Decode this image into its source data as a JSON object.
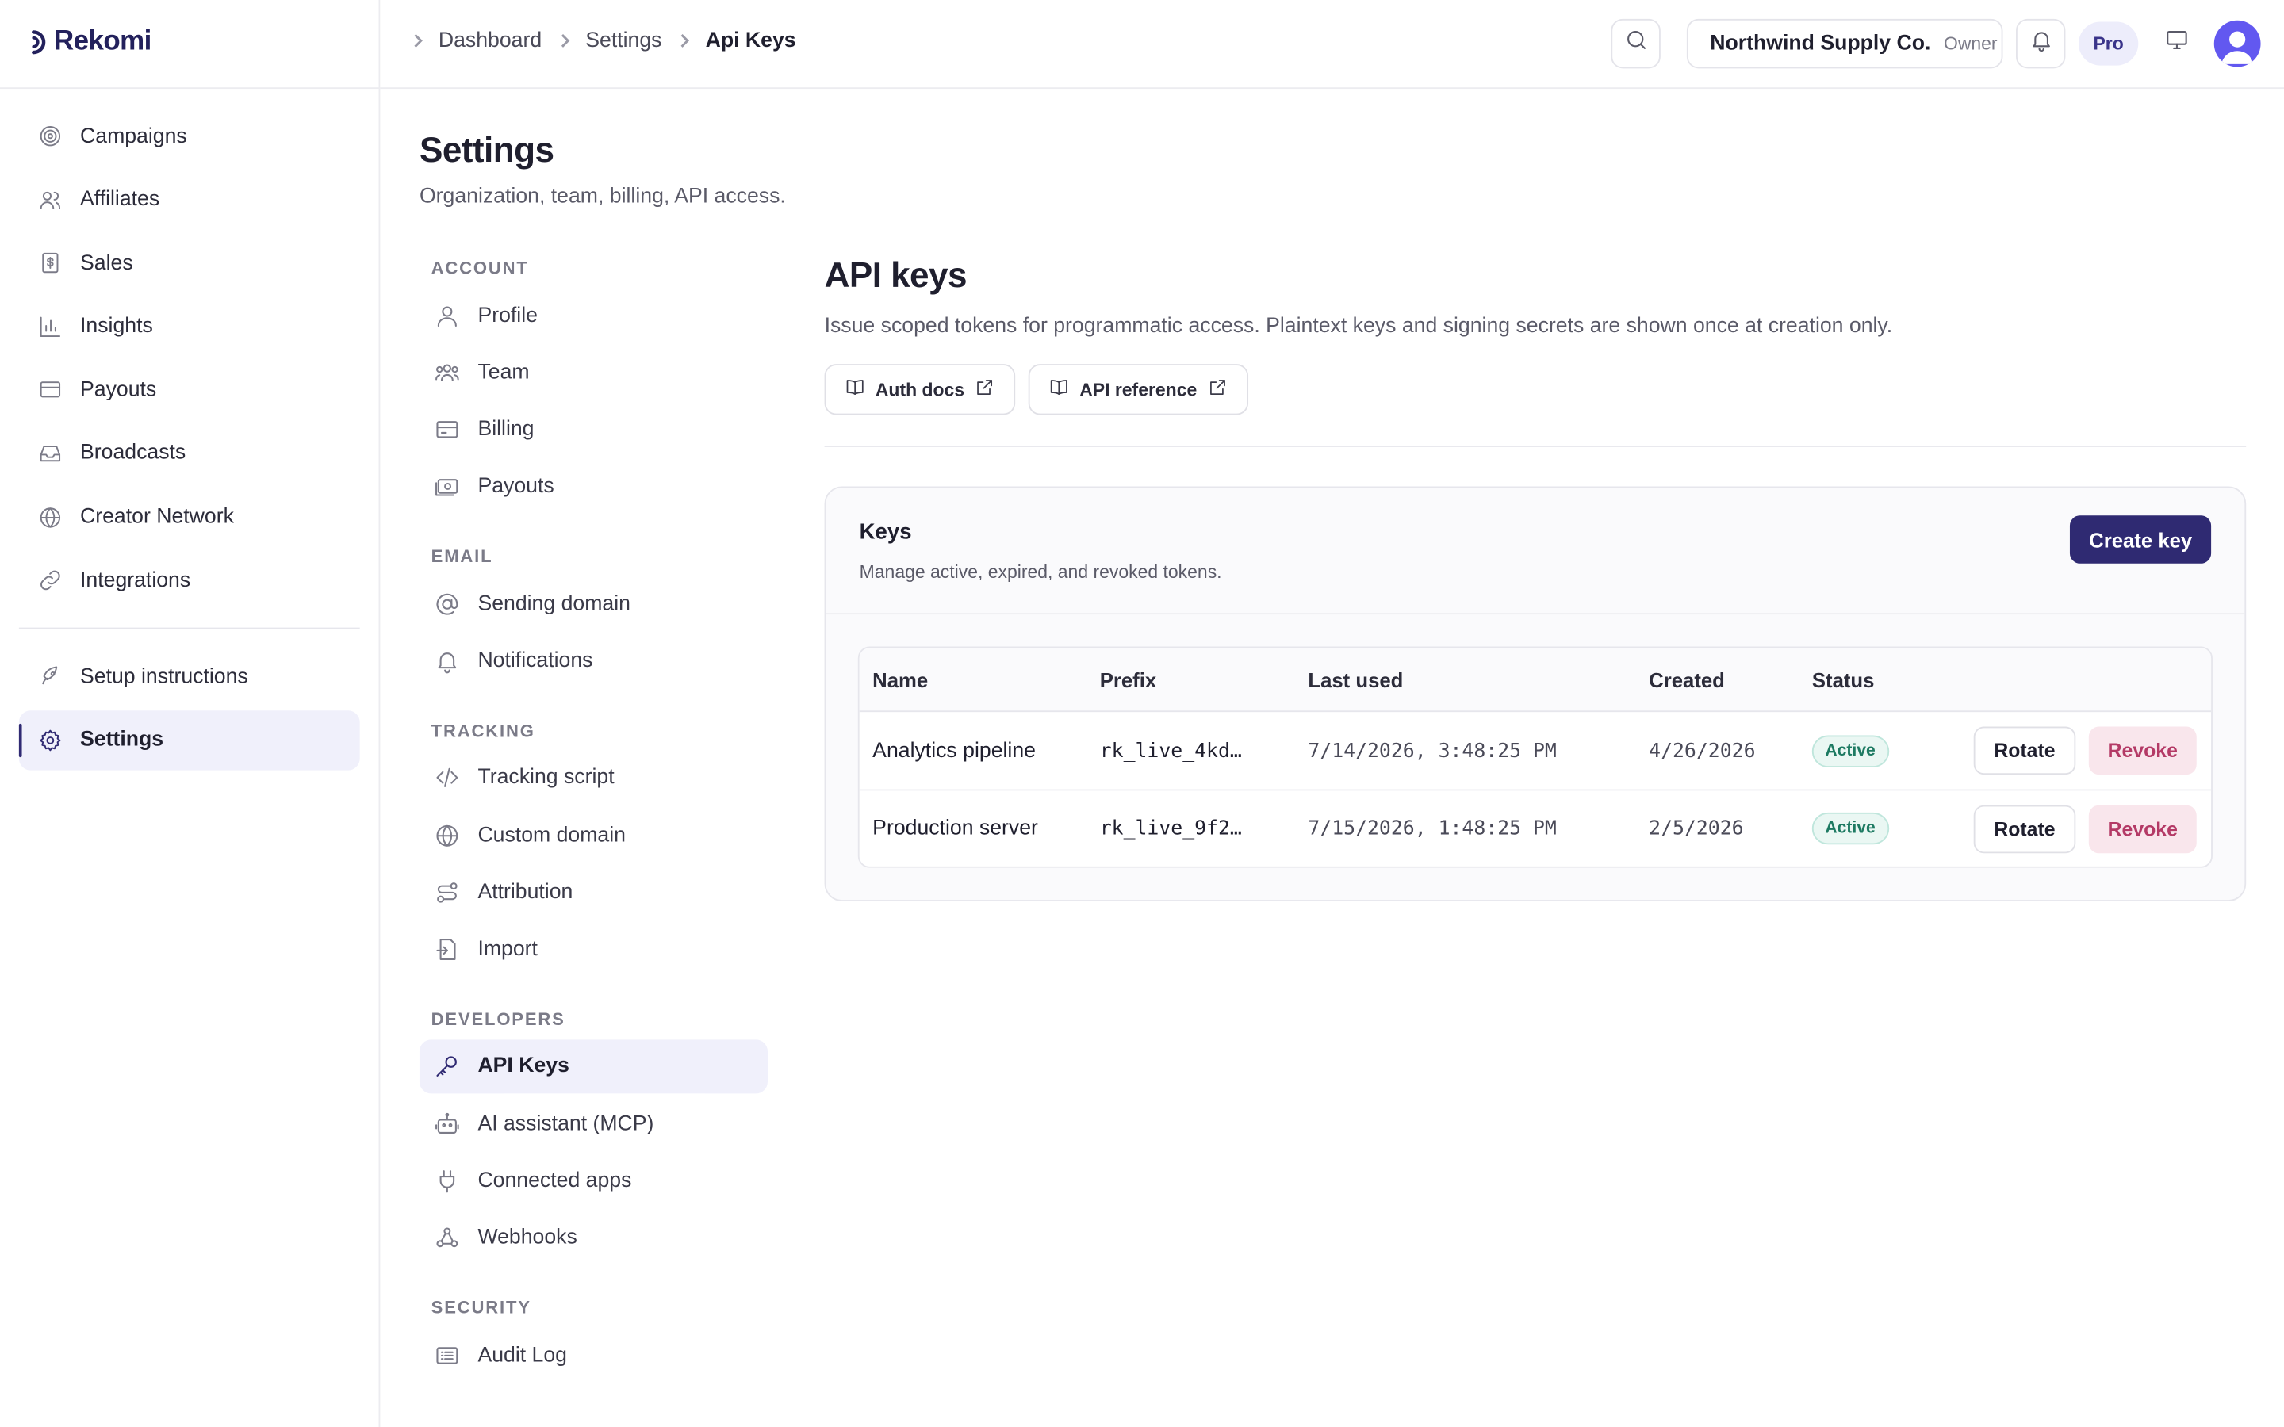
{
  "app": {
    "brand": "Rekomi"
  },
  "sidebar": {
    "items": [
      {
        "label": "Campaigns",
        "icon": "target-icon"
      },
      {
        "label": "Affiliates",
        "icon": "users-icon"
      },
      {
        "label": "Sales",
        "icon": "receipt-icon"
      },
      {
        "label": "Insights",
        "icon": "bar-chart-icon"
      },
      {
        "label": "Payouts",
        "icon": "credit-card-icon"
      },
      {
        "label": "Broadcasts",
        "icon": "inbox-icon"
      },
      {
        "label": "Creator Network",
        "icon": "globe-icon"
      },
      {
        "label": "Integrations",
        "icon": "link-icon"
      }
    ],
    "bottom_items": [
      {
        "label": "Setup instructions",
        "icon": "rocket-icon"
      },
      {
        "label": "Settings",
        "icon": "gear-icon",
        "active": true
      }
    ]
  },
  "topbar": {
    "breadcrumbs": [
      "Dashboard",
      "Settings",
      "Api Keys"
    ],
    "org_name": "Northwind Supply Co.",
    "org_role": "Owner",
    "plan_badge": "Pro"
  },
  "page": {
    "title": "Settings",
    "subtitle": "Organization, team, billing, API access."
  },
  "settings_nav": {
    "sections": [
      {
        "title": "ACCOUNT",
        "items": [
          {
            "label": "Profile",
            "icon": "user-icon"
          },
          {
            "label": "Team",
            "icon": "users-icon"
          },
          {
            "label": "Billing",
            "icon": "credit-card-icon"
          },
          {
            "label": "Payouts",
            "icon": "banknote-icon"
          }
        ]
      },
      {
        "title": "EMAIL",
        "items": [
          {
            "label": "Sending domain",
            "icon": "at-sign-icon"
          },
          {
            "label": "Notifications",
            "icon": "bell-icon"
          }
        ]
      },
      {
        "title": "TRACKING",
        "items": [
          {
            "label": "Tracking script",
            "icon": "code-icon"
          },
          {
            "label": "Custom domain",
            "icon": "globe-icon"
          },
          {
            "label": "Attribution",
            "icon": "route-icon"
          },
          {
            "label": "Import",
            "icon": "file-import-icon"
          }
        ]
      },
      {
        "title": "DEVELOPERS",
        "items": [
          {
            "label": "API Keys",
            "icon": "key-icon",
            "active": true
          },
          {
            "label": "AI assistant (MCP)",
            "icon": "bot-icon"
          },
          {
            "label": "Connected apps",
            "icon": "plug-icon"
          },
          {
            "label": "Webhooks",
            "icon": "webhook-icon"
          }
        ]
      },
      {
        "title": "SECURITY",
        "items": [
          {
            "label": "Audit Log",
            "icon": "log-icon"
          }
        ]
      }
    ]
  },
  "api_keys": {
    "title": "API keys",
    "description": "Issue scoped tokens for programmatic access. Plaintext keys and signing secrets are shown once at creation only.",
    "links": [
      {
        "label": "Auth docs"
      },
      {
        "label": "API reference"
      }
    ],
    "card": {
      "title": "Keys",
      "subtitle": "Manage active, expired, and revoked tokens.",
      "create_label": "Create key"
    },
    "table": {
      "columns": [
        "Name",
        "Prefix",
        "Last used",
        "Created",
        "Status"
      ],
      "rows": [
        {
          "name": "Analytics pipeline",
          "prefix": "rk_live_4kd…",
          "last_used": "7/14/2026, 3:48:25 PM",
          "created": "4/26/2026",
          "status": "Active",
          "rotate": "Rotate",
          "revoke": "Revoke"
        },
        {
          "name": "Production server",
          "prefix": "rk_live_9f2…",
          "last_used": "7/15/2026, 1:48:25 PM",
          "created": "2/5/2026",
          "status": "Active",
          "rotate": "Rotate",
          "revoke": "Revoke"
        }
      ]
    }
  },
  "colors": {
    "brand": "#23215c",
    "primary_button": "#2f2a72",
    "active_bg": "#f0f0fb",
    "status_active": "#1d7a62",
    "revoke": "#b43a66",
    "avatar": "#6258f0"
  }
}
